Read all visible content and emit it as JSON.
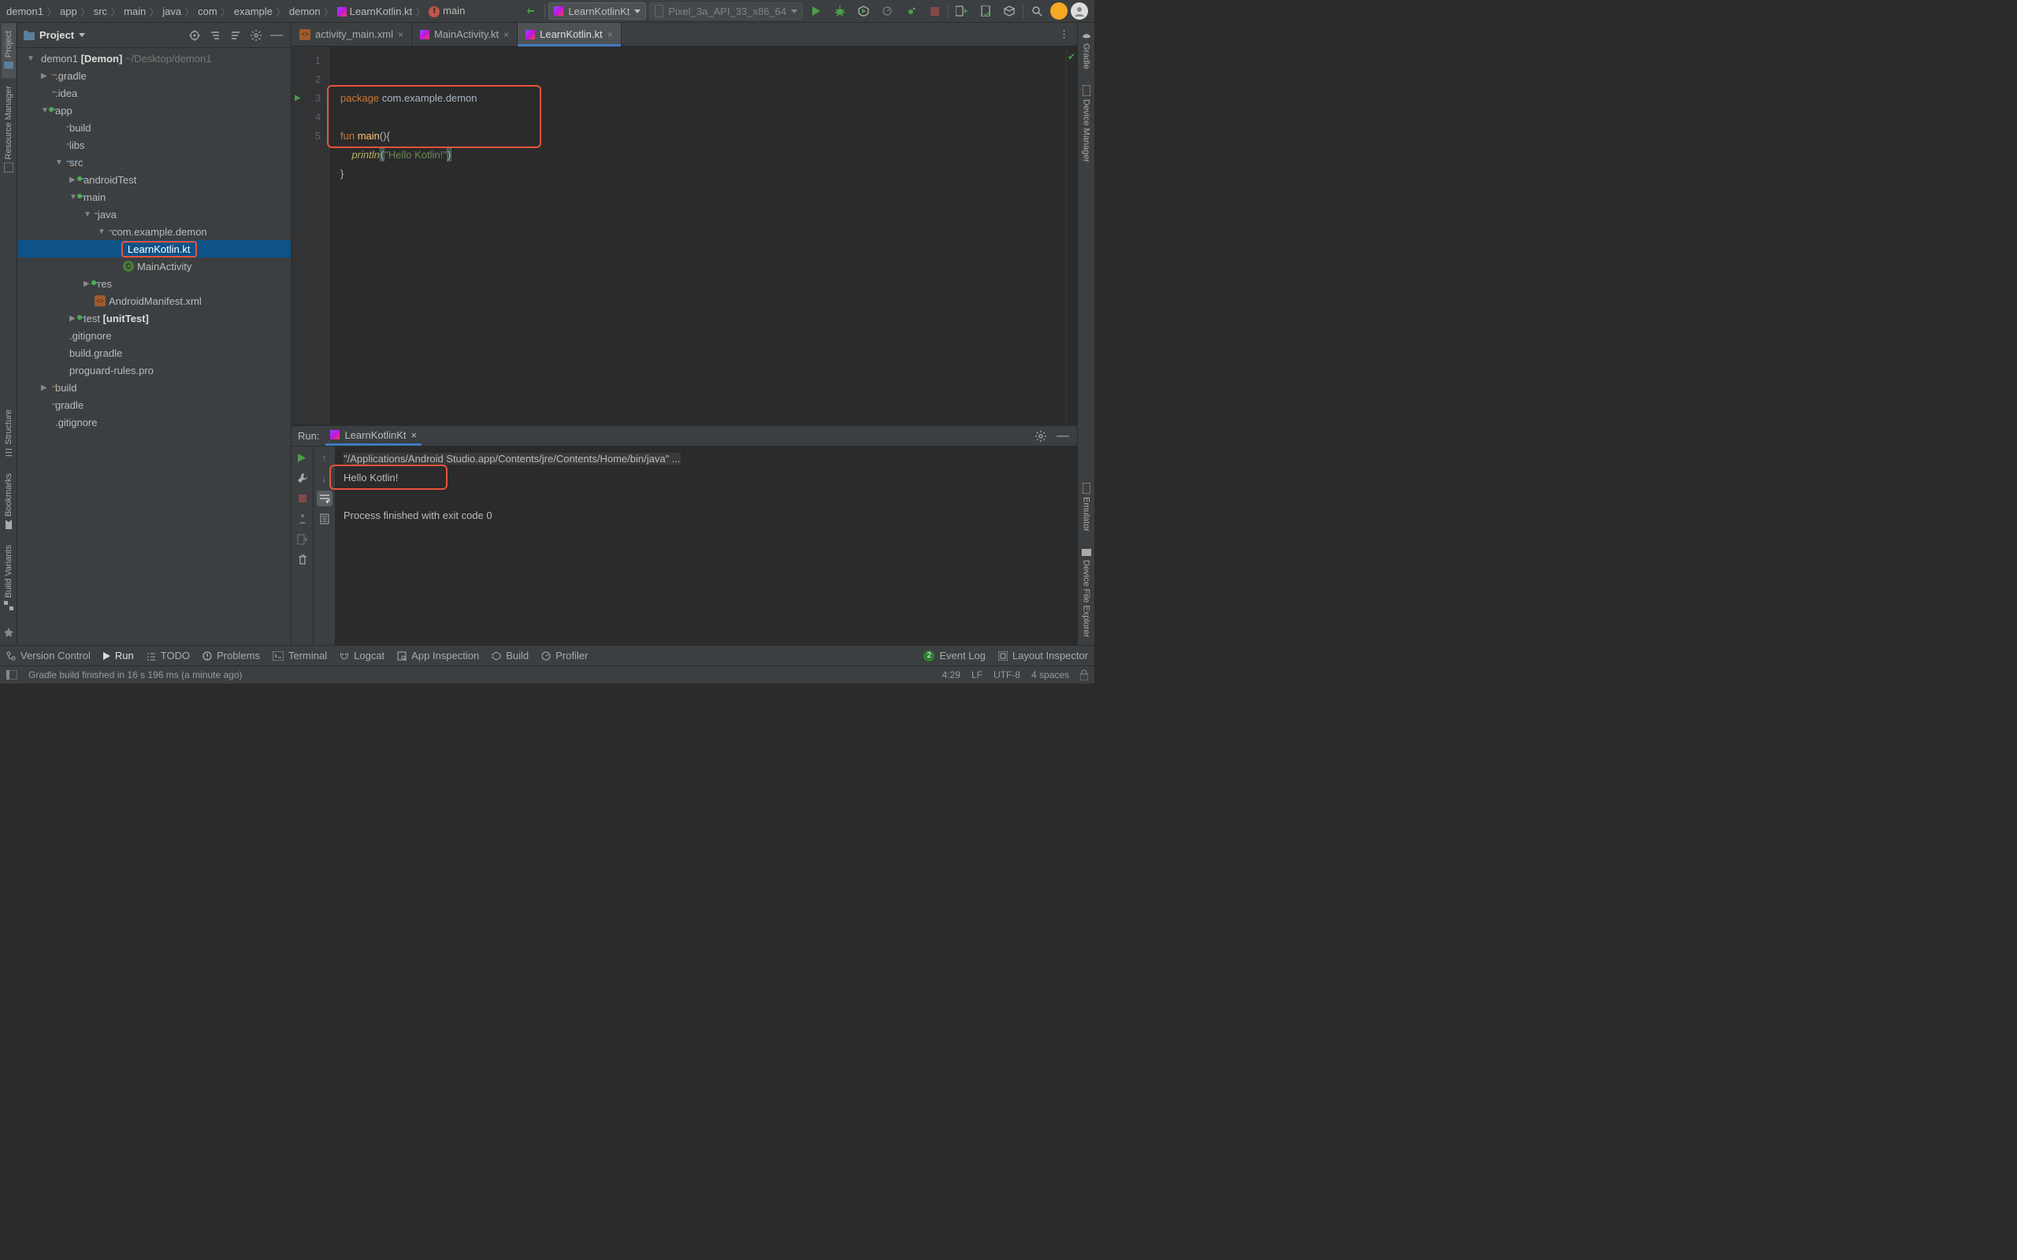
{
  "breadcrumb": [
    "demon1",
    "app",
    "src",
    "main",
    "java",
    "com",
    "example",
    "demon",
    "LearnKotlin.kt",
    "main"
  ],
  "breadcrumb_file_index": 8,
  "breadcrumb_fn_index": 9,
  "runConfig": {
    "name": "LearnKotlinKt"
  },
  "device": {
    "name": "Pixel_3a_API_33_x86_64"
  },
  "projectHeader": {
    "title": "Project"
  },
  "tree": [
    {
      "d": 0,
      "exp": "open",
      "ico": "proj",
      "label": "demon1",
      "bold": "[Demon]",
      "dim": "~/Desktop/demon1"
    },
    {
      "d": 1,
      "exp": "closed",
      "ico": "folder",
      "label": ".gradle"
    },
    {
      "d": 1,
      "exp": "none",
      "ico": "folder-dim",
      "label": ".idea"
    },
    {
      "d": 1,
      "exp": "open",
      "ico": "mod",
      "label": "app",
      "green": true
    },
    {
      "d": 2,
      "exp": "none",
      "ico": "folder-dim",
      "label": "build"
    },
    {
      "d": 2,
      "exp": "none",
      "ico": "folder-dim",
      "label": "libs"
    },
    {
      "d": 2,
      "exp": "open",
      "ico": "folder-blue",
      "label": "src"
    },
    {
      "d": 3,
      "exp": "closed",
      "ico": "folder-blue",
      "label": "androidTest",
      "green": true
    },
    {
      "d": 3,
      "exp": "open",
      "ico": "folder-blue",
      "label": "main",
      "green": true
    },
    {
      "d": 4,
      "exp": "open",
      "ico": "folder-blue",
      "label": "java"
    },
    {
      "d": 5,
      "exp": "open",
      "ico": "folder-dim",
      "label": "com.example.demon"
    },
    {
      "d": 6,
      "exp": "none",
      "ico": "kt",
      "label": "LearnKotlin.kt",
      "selected": true,
      "highlighted": true
    },
    {
      "d": 6,
      "exp": "none",
      "ico": "cls",
      "label": "MainActivity"
    },
    {
      "d": 4,
      "exp": "closed",
      "ico": "folder-blue",
      "label": "res",
      "green": true
    },
    {
      "d": 4,
      "exp": "none",
      "ico": "xml",
      "label": "AndroidManifest.xml"
    },
    {
      "d": 3,
      "exp": "closed",
      "ico": "folder-blue",
      "label": "test",
      "bold": "[unitTest]",
      "green": true
    },
    {
      "d": 2,
      "exp": "none",
      "ico": "file",
      "label": ".gitignore"
    },
    {
      "d": 2,
      "exp": "none",
      "ico": "file",
      "label": "build.gradle"
    },
    {
      "d": 2,
      "exp": "none",
      "ico": "file",
      "label": "proguard-rules.pro"
    },
    {
      "d": 1,
      "exp": "closed",
      "ico": "folder",
      "label": "build"
    },
    {
      "d": 1,
      "exp": "none",
      "ico": "folder-dim",
      "label": "gradle"
    },
    {
      "d": 1,
      "exp": "none",
      "ico": "file",
      "label": ".gitignore"
    }
  ],
  "editorTabs": [
    {
      "ico": "xml",
      "label": "activity_main.xml",
      "active": false
    },
    {
      "ico": "kt",
      "label": "MainActivity.kt",
      "active": false
    },
    {
      "ico": "kt",
      "label": "LearnKotlin.kt",
      "active": true
    }
  ],
  "code": {
    "lines": [
      "1",
      "2",
      "3",
      "4",
      "5"
    ],
    "l1_kw": "package",
    "l1_rest": " com.example.demon",
    "l3_kw": "fun ",
    "l3_fn": "main",
    "l3_rest": "(){",
    "l4_pre": "    ",
    "l4_fn": "println",
    "l4_p1": "(",
    "l4_str": "\"Hello Kotlin!\"",
    "l4_p2": ")",
    "l5": "}"
  },
  "run": {
    "title": "Run:",
    "tab": "LearnKotlinKt",
    "cmd": "\"/Applications/Android Studio.app/Contents/jre/Contents/Home/bin/java\" ...",
    "out": "Hello Kotlin!",
    "exit": "Process finished with exit code 0"
  },
  "leftRail": [
    "Project",
    "Resource Manager",
    "Structure",
    "Bookmarks",
    "Build Variants"
  ],
  "rightRail": [
    "Gradle",
    "Device Manager",
    "Emulator",
    "Device File Explorer"
  ],
  "bottomTools": {
    "vcs": "Version Control",
    "run": "Run",
    "todo": "TODO",
    "problems": "Problems",
    "terminal": "Terminal",
    "logcat": "Logcat",
    "appinsp": "App Inspection",
    "build": "Build",
    "profiler": "Profiler",
    "eventlog": "Event Log",
    "eventCount": "2",
    "layout": "Layout Inspector"
  },
  "status": {
    "msg": "Gradle build finished in 16 s 196 ms (a minute ago)",
    "pos": "4:29",
    "le": "LF",
    "enc": "UTF-8",
    "indent": "4 spaces"
  }
}
